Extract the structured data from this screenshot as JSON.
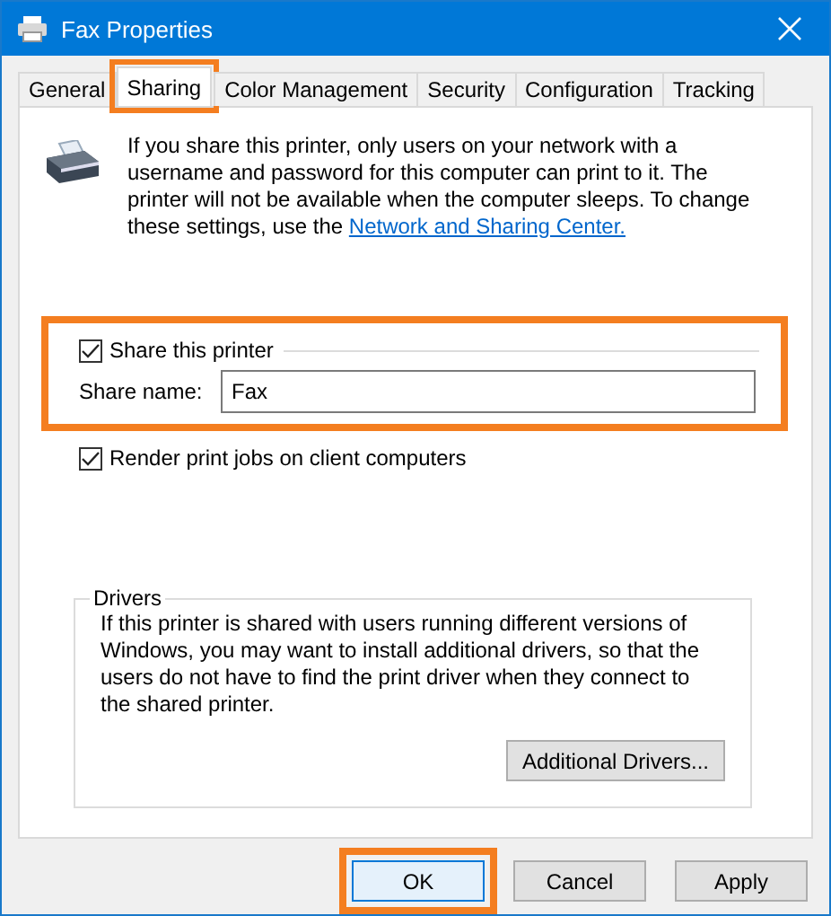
{
  "window": {
    "title": "Fax Properties"
  },
  "tabs": [
    {
      "label": "General",
      "selected": false,
      "highlighted": false
    },
    {
      "label": "Sharing",
      "selected": true,
      "highlighted": true
    },
    {
      "label": "Color Management",
      "selected": false,
      "highlighted": false
    },
    {
      "label": "Security",
      "selected": false,
      "highlighted": false
    },
    {
      "label": "Configuration",
      "selected": false,
      "highlighted": false
    },
    {
      "label": "Tracking",
      "selected": false,
      "highlighted": false
    }
  ],
  "intro": {
    "text": "If you share this printer, only users on your network with a username and password for this computer can print to it. The printer will not be available when the computer sleeps. To change these settings, use the",
    "link": "Network and Sharing Center."
  },
  "share": {
    "highlighted": true,
    "checkbox": {
      "label": "Share this printer",
      "checked": true
    },
    "name_label": "Share name:",
    "name_value": "Fax"
  },
  "render": {
    "label": "Render print jobs on client computers",
    "checked": true
  },
  "drivers": {
    "title": "Drivers",
    "text": "If this printer is shared with users running different versions of Windows, you may want to install additional drivers, so that the users do not have to find the print driver when they connect to the shared printer.",
    "button": "Additional Drivers..."
  },
  "buttons": [
    {
      "label": "OK",
      "default": true,
      "highlighted": true
    },
    {
      "label": "Cancel",
      "default": false,
      "highlighted": false
    },
    {
      "label": "Apply",
      "default": false,
      "highlighted": false
    }
  ]
}
